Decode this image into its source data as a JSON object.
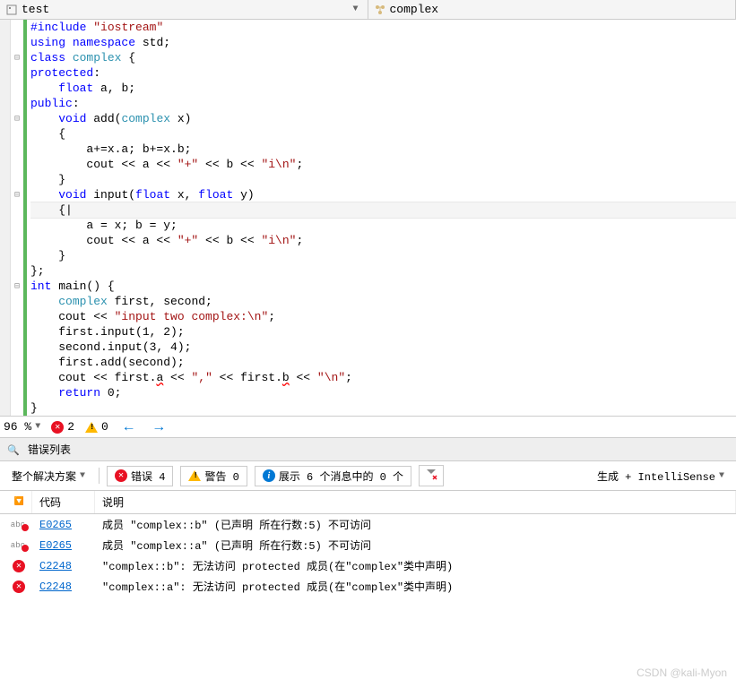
{
  "breadcrumb": {
    "item1": "test",
    "item2": "complex"
  },
  "code": {
    "lines": [
      {
        "indent": 0,
        "tokens": [
          [
            "",
            ""
          ],
          [
            "kw",
            "#include"
          ],
          [
            "",
            " "
          ],
          [
            "str",
            "\"iostream\""
          ]
        ]
      },
      {
        "indent": 0,
        "tokens": [
          [
            "kw",
            "using"
          ],
          [
            "",
            " "
          ],
          [
            "kw",
            "namespace"
          ],
          [
            "",
            " std;"
          ]
        ]
      },
      {
        "indent": 0,
        "fold": "-",
        "tokens": [
          [
            "kw",
            "class"
          ],
          [
            "",
            " "
          ],
          [
            "cls",
            "complex"
          ],
          [
            "",
            " {"
          ]
        ]
      },
      {
        "indent": 0,
        "tokens": [
          [
            "kw",
            "protected"
          ],
          [
            "",
            ":"
          ]
        ]
      },
      {
        "indent": 1,
        "tokens": [
          [
            "kw",
            "float"
          ],
          [
            "",
            " a, b;"
          ]
        ]
      },
      {
        "indent": 0,
        "tokens": [
          [
            "kw",
            "public"
          ],
          [
            "",
            ":"
          ]
        ]
      },
      {
        "indent": 1,
        "fold": "-",
        "tokens": [
          [
            "kw",
            "void"
          ],
          [
            "",
            " add("
          ],
          [
            "cls",
            "complex"
          ],
          [
            "",
            " x)"
          ]
        ]
      },
      {
        "indent": 1,
        "tokens": [
          [
            "",
            "{"
          ]
        ]
      },
      {
        "indent": 2,
        "tokens": [
          [
            "",
            "a+=x.a; b+=x.b;"
          ]
        ]
      },
      {
        "indent": 2,
        "tokens": [
          [
            "",
            "cout << a << "
          ],
          [
            "str",
            "\"+\""
          ],
          [
            "",
            " << b << "
          ],
          [
            "str",
            "\"i\\n\""
          ],
          [
            "",
            ";"
          ]
        ]
      },
      {
        "indent": 1,
        "tokens": [
          [
            "",
            "}"
          ]
        ]
      },
      {
        "indent": 1,
        "fold": "-",
        "tokens": [
          [
            "kw",
            "void"
          ],
          [
            "",
            " input("
          ],
          [
            "kw",
            "float"
          ],
          [
            "",
            " x, "
          ],
          [
            "kw",
            "float"
          ],
          [
            "",
            " y)"
          ]
        ]
      },
      {
        "indent": 1,
        "current": true,
        "tokens": [
          [
            "",
            "{|"
          ]
        ]
      },
      {
        "indent": 2,
        "tokens": [
          [
            "",
            "a = x; b = y;"
          ]
        ]
      },
      {
        "indent": 2,
        "tokens": [
          [
            "",
            "cout << a << "
          ],
          [
            "str",
            "\"+\""
          ],
          [
            "",
            " << b << "
          ],
          [
            "str",
            "\"i\\n\""
          ],
          [
            "",
            ";"
          ]
        ]
      },
      {
        "indent": 1,
        "tokens": [
          [
            "",
            "}"
          ]
        ]
      },
      {
        "indent": 0,
        "tokens": [
          [
            "",
            "};"
          ]
        ]
      },
      {
        "indent": 0,
        "fold": "-",
        "tokens": [
          [
            "kw",
            "int"
          ],
          [
            "",
            " main() {"
          ]
        ]
      },
      {
        "indent": 1,
        "tokens": [
          [
            "cls",
            "complex"
          ],
          [
            "",
            " first, second;"
          ]
        ]
      },
      {
        "indent": 1,
        "tokens": [
          [
            "",
            "cout << "
          ],
          [
            "str",
            "\"input two complex:\\n\""
          ],
          [
            "",
            ";"
          ]
        ]
      },
      {
        "indent": 1,
        "tokens": [
          [
            "",
            "first.input(1, 2);"
          ]
        ]
      },
      {
        "indent": 1,
        "tokens": [
          [
            "",
            "second.input(3, 4);"
          ]
        ]
      },
      {
        "indent": 1,
        "tokens": [
          [
            "",
            "first.add(second);"
          ]
        ]
      },
      {
        "indent": 1,
        "tokens": [
          [
            "",
            "cout << first."
          ],
          [
            "err",
            "a"
          ],
          [
            "",
            " << "
          ],
          [
            "str",
            "\",\""
          ],
          [
            "",
            " << first."
          ],
          [
            "err",
            "b"
          ],
          [
            "",
            " << "
          ],
          [
            "str",
            "\"\\n\""
          ],
          [
            "",
            ";"
          ]
        ]
      },
      {
        "indent": 1,
        "tokens": [
          [
            "kw",
            "return"
          ],
          [
            "",
            " 0;"
          ]
        ]
      },
      {
        "indent": 0,
        "tokens": [
          [
            "",
            "}"
          ]
        ]
      }
    ]
  },
  "status": {
    "zoom": "96 %",
    "errors": "2",
    "warnings": "0"
  },
  "panel": {
    "title": "错误列表",
    "scope": "整个解决方案",
    "err_btn": "错误 4",
    "warn_btn": "警告 0",
    "info_btn": "展示 6 个消息中的 0 个",
    "build_filter": "生成 + IntelliSense",
    "columns": {
      "code": "代码",
      "desc": "说明"
    },
    "rows": [
      {
        "icon": "abc",
        "code": "E0265",
        "desc": "成员 \"complex::b\" (已声明 所在行数:5) 不可访问"
      },
      {
        "icon": "abc",
        "code": "E0265",
        "desc": "成员 \"complex::a\" (已声明 所在行数:5) 不可访问"
      },
      {
        "icon": "err",
        "code": "C2248",
        "desc": "\"complex::b\": 无法访问 protected 成员(在\"complex\"类中声明)"
      },
      {
        "icon": "err",
        "code": "C2248",
        "desc": "\"complex::a\": 无法访问 protected 成员(在\"complex\"类中声明)"
      }
    ]
  },
  "watermark": "CSDN @kali-Myon"
}
